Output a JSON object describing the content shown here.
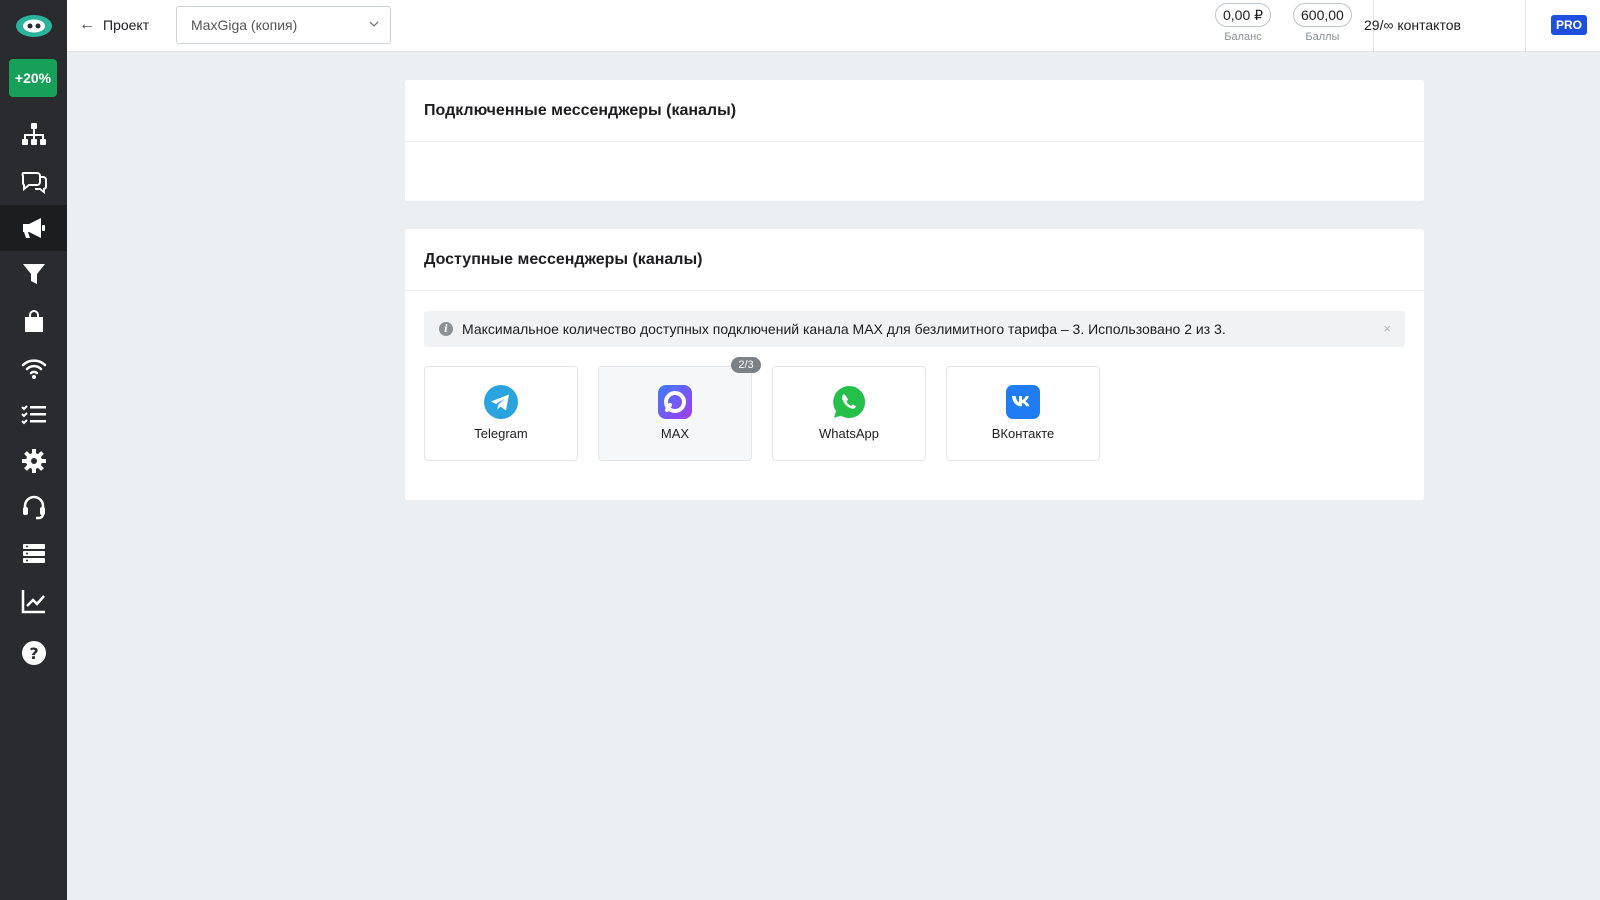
{
  "sidebar": {
    "promo_label": "+20%",
    "items": [
      {
        "icon": "sitemap-icon",
        "active": false
      },
      {
        "icon": "chat-icon",
        "active": false
      },
      {
        "icon": "megaphone-icon",
        "active": true
      },
      {
        "icon": "funnel-icon",
        "active": false
      },
      {
        "icon": "shopping-bag-icon",
        "active": false
      },
      {
        "icon": "wifi-icon",
        "active": false
      },
      {
        "icon": "checklist-icon",
        "active": false
      },
      {
        "icon": "gear-icon",
        "active": false
      },
      {
        "icon": "support-icon",
        "active": false
      },
      {
        "icon": "database-icon",
        "active": false
      },
      {
        "icon": "analytics-icon",
        "active": false
      },
      {
        "icon": "help-icon",
        "active": false
      }
    ]
  },
  "topbar": {
    "back_label": "Проект",
    "project_name": "MaxGiga (копия)",
    "balance_value": "0,00 ₽",
    "balance_label": "Баланс",
    "points_value": "600,00",
    "points_label": "Баллы",
    "contacts_label": "29/∞ контактов",
    "plan_badge": "PRO"
  },
  "connected": {
    "title": "Подключенные мессенджеры (каналы)"
  },
  "available": {
    "title": "Доступные мессенджеры (каналы)",
    "alert_text": "Максимальное количество доступных подключений канала MAX для безлимитного тарифа – 3. Использовано 2 из 3.",
    "alert_close": "×",
    "channels": [
      {
        "label": "Telegram",
        "icon": "telegram-icon"
      },
      {
        "label": "MAX",
        "icon": "max-icon",
        "usage": "2/3"
      },
      {
        "label": "WhatsApp",
        "icon": "whatsapp-icon"
      },
      {
        "label": "ВКонтакте",
        "icon": "vk-icon"
      }
    ]
  },
  "colors": {
    "sidebar_bg": "#2a2b2e",
    "promo_green": "#17a05a",
    "pro_blue": "#1f4fe0",
    "telegram": "#2aa3df",
    "whatsapp": "#25c04a",
    "vk": "#1f7cf4"
  }
}
